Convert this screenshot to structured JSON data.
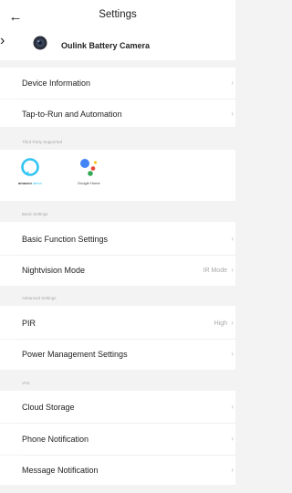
{
  "header": {
    "title": "Settings",
    "back_icon": "back-arrow-icon"
  },
  "device": {
    "name": "Oulink Battery Camera",
    "icon": "camera-lens-icon"
  },
  "rows": {
    "device_information": {
      "label": "Device Information"
    },
    "tap_to_run": {
      "label": "Tap-to-Run and Automation"
    },
    "basic_function": {
      "label": "Basic Function Settings"
    },
    "nightvision": {
      "label": "Nightvision Mode",
      "value": "IR Mode"
    },
    "pir": {
      "label": "PIR",
      "value": "High"
    },
    "power_management": {
      "label": "Power Management Settings"
    },
    "cloud_storage": {
      "label": "Cloud Storage"
    },
    "phone_notification": {
      "label": "Phone Notification"
    },
    "message_notification": {
      "label": "Message Notification"
    }
  },
  "sections": {
    "third_party": "Third Party Supported",
    "basic": "Basic Settings",
    "advanced": "Advanced Settings",
    "vas": "VAS"
  },
  "third_party": {
    "alexa": {
      "icon": "alexa-icon",
      "caption_main": "amazon",
      "caption_accent": "alexa"
    },
    "google": {
      "icon": "google-assistant-icon",
      "caption": "Google Home"
    }
  },
  "chevron_glyph": "›",
  "colors": {
    "alexa_blue": "#31c4f3",
    "google_blue": "#4285f4",
    "google_red": "#ea4335",
    "google_yellow": "#fbbc05",
    "google_green": "#34a853"
  }
}
